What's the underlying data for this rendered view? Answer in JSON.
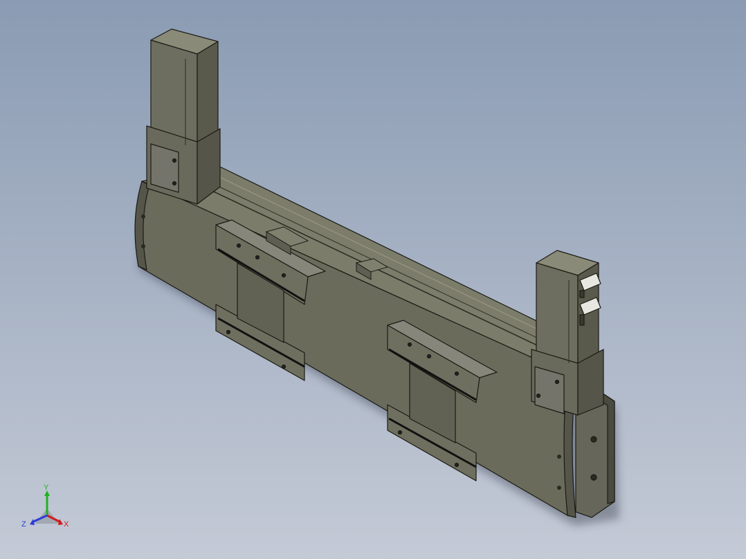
{
  "viewport": {
    "background_top": "#8a9bb3",
    "background_bottom": "#c4cad6",
    "model_color": "#6b6b5c",
    "model_shadow": "#3f3f35",
    "model_highlight": "#8c8c7a"
  },
  "triad": {
    "x_label": "X",
    "y_label": "Y",
    "z_label": "Z",
    "x_color": "#d01c1c",
    "y_color": "#1fb31f",
    "z_color": "#2a3cd6"
  }
}
